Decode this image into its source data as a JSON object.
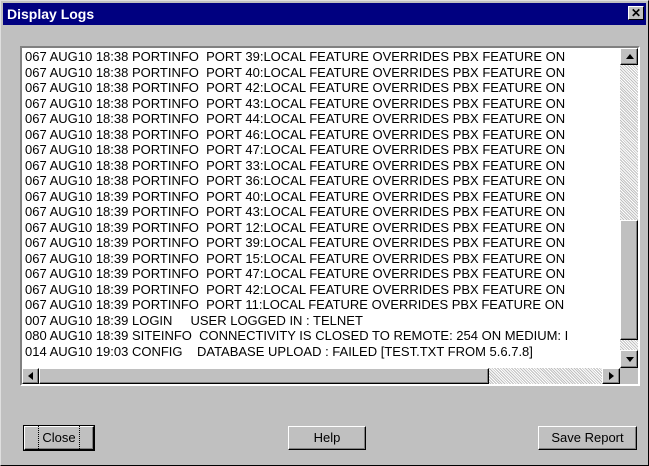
{
  "window": {
    "title": "Display Logs"
  },
  "log_lines": [
    "067 AUG10 18:38 PORTINFO  PORT 39:LOCAL FEATURE OVERRIDES PBX FEATURE ON",
    "067 AUG10 18:38 PORTINFO  PORT 40:LOCAL FEATURE OVERRIDES PBX FEATURE ON",
    "067 AUG10 18:38 PORTINFO  PORT 42:LOCAL FEATURE OVERRIDES PBX FEATURE ON",
    "067 AUG10 18:38 PORTINFO  PORT 43:LOCAL FEATURE OVERRIDES PBX FEATURE ON",
    "067 AUG10 18:38 PORTINFO  PORT 44:LOCAL FEATURE OVERRIDES PBX FEATURE ON",
    "067 AUG10 18:38 PORTINFO  PORT 46:LOCAL FEATURE OVERRIDES PBX FEATURE ON",
    "067 AUG10 18:38 PORTINFO  PORT 47:LOCAL FEATURE OVERRIDES PBX FEATURE ON",
    "067 AUG10 18:38 PORTINFO  PORT 33:LOCAL FEATURE OVERRIDES PBX FEATURE ON",
    "067 AUG10 18:38 PORTINFO  PORT 36:LOCAL FEATURE OVERRIDES PBX FEATURE ON",
    "067 AUG10 18:39 PORTINFO  PORT 40:LOCAL FEATURE OVERRIDES PBX FEATURE ON",
    "067 AUG10 18:39 PORTINFO  PORT 43:LOCAL FEATURE OVERRIDES PBX FEATURE ON",
    "067 AUG10 18:39 PORTINFO  PORT 12:LOCAL FEATURE OVERRIDES PBX FEATURE ON",
    "067 AUG10 18:39 PORTINFO  PORT 39:LOCAL FEATURE OVERRIDES PBX FEATURE ON",
    "067 AUG10 18:39 PORTINFO  PORT 15:LOCAL FEATURE OVERRIDES PBX FEATURE ON",
    "067 AUG10 18:39 PORTINFO  PORT 47:LOCAL FEATURE OVERRIDES PBX FEATURE ON",
    "067 AUG10 18:39 PORTINFO  PORT 42:LOCAL FEATURE OVERRIDES PBX FEATURE ON",
    "067 AUG10 18:39 PORTINFO  PORT 11:LOCAL FEATURE OVERRIDES PBX FEATURE ON",
    "007 AUG10 18:39 LOGIN     USER LOGGED IN : TELNET",
    "080 AUG10 18:39 SITEINFO  CONNECTIVITY IS CLOSED TO REMOTE: 254 ON MEDIUM: I",
    "014 AUG10 19:03 CONFIG    DATABASE UPLOAD : FAILED [TEST.TXT FROM 5.6.7.8]"
  ],
  "buttons": {
    "close": "Close",
    "help": "Help",
    "save_report": "Save Report"
  },
  "icons": {
    "close": "close-icon",
    "up": "arrow-up-icon",
    "down": "arrow-down-icon",
    "left": "arrow-left-icon",
    "right": "arrow-right-icon"
  },
  "colors": {
    "titlebar": "#000080",
    "face": "#c0c0c0"
  }
}
